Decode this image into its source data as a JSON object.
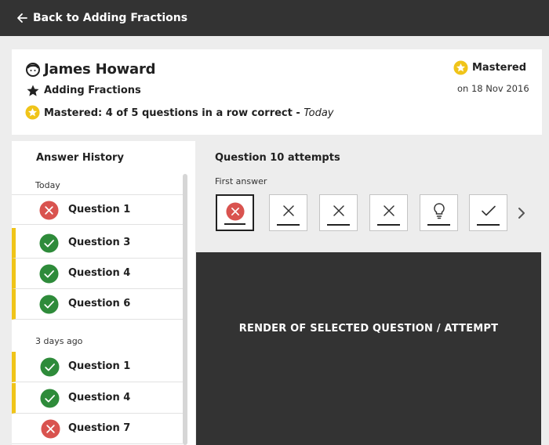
{
  "topbar": {
    "back_label": "Back to Adding Fractions"
  },
  "learner": {
    "name": "James Howard",
    "topic": "Adding Fractions",
    "status_text": "Mastered: 4 of 5 questions in a row correct - ",
    "status_when": "Today",
    "badge_label": "Mastered",
    "badge_date": "on 18 Nov 2016"
  },
  "history": {
    "title": "Answer History",
    "groups": [
      {
        "label": "Today",
        "rows": [
          {
            "label": "Question 1",
            "result": "incorrect",
            "flag": false
          },
          {
            "label": "Question 3",
            "result": "correct",
            "flag": true
          },
          {
            "label": "Question 4",
            "result": "correct",
            "flag": true
          },
          {
            "label": "Question 6",
            "result": "correct",
            "flag": true
          }
        ]
      },
      {
        "label": "3 days ago",
        "rows": [
          {
            "label": "Question 1",
            "result": "correct",
            "flag": true
          },
          {
            "label": "Question 4",
            "result": "correct",
            "flag": true
          },
          {
            "label": "Question 7",
            "result": "incorrect",
            "flag": false
          }
        ]
      }
    ]
  },
  "attempts": {
    "title": "Question 10 attempts",
    "first_answer_label": "First answer",
    "items": [
      "incorrect-selected",
      "incorrect",
      "incorrect",
      "incorrect",
      "hint",
      "correct"
    ]
  },
  "render": {
    "label": "RENDER OF SELECTED QUESTION / ATTEMPT"
  },
  "colors": {
    "accent_gold": "#f0c419",
    "correct_green": "#2e8b3a",
    "incorrect_red": "#d9534f",
    "dark_bar": "#333333"
  },
  "icons": [
    "back-arrow-icon",
    "learner-face-icon",
    "star-icon",
    "gold-star-icon",
    "check-circle-icon",
    "x-circle-icon",
    "x-icon",
    "lightbulb-icon",
    "check-icon",
    "chevron-right-icon"
  ]
}
